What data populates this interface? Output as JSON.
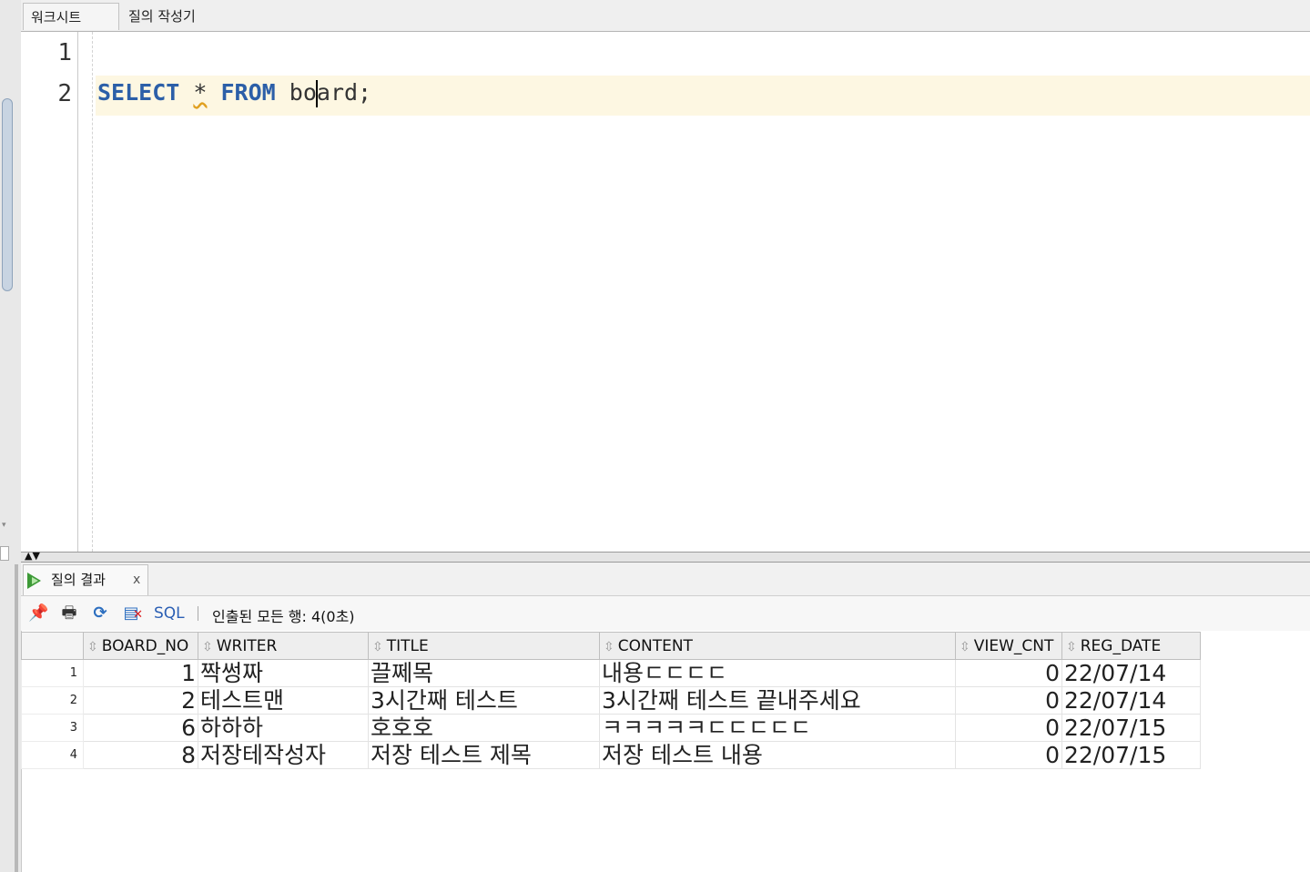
{
  "tabs": {
    "worksheet": "워크시트",
    "query_builder": "질의 작성기"
  },
  "editor": {
    "line_numbers": [
      "1",
      "2"
    ],
    "sql": {
      "kw_select": "SELECT",
      "star": "*",
      "kw_from": "FROM",
      "table_before_caret": "bo",
      "table_after_caret": "ard;"
    }
  },
  "results": {
    "tab_label": "질의 결과",
    "close": "x",
    "toolbar": {
      "sql_label": "SQL",
      "status": "인출된 모든 행: 4(0초)"
    },
    "columns": [
      "BOARD_NO",
      "WRITER",
      "TITLE",
      "CONTENT",
      "VIEW_CNT",
      "REG_DATE"
    ],
    "rows": [
      [
        "1",
        "1",
        "짝썽짜",
        "끌쩨목",
        "내용ㄷㄷㄷㄷ",
        "0",
        "22/07/14"
      ],
      [
        "2",
        "2",
        "테스트맨",
        "3시간째 테스트",
        "3시간째 테스트 끝내주세요",
        "0",
        "22/07/14"
      ],
      [
        "3",
        "6",
        "하하하",
        "호호호",
        "ㅋㅋㅋㅋㅋㄷㄷㄷㄷㄷ",
        "0",
        "22/07/15"
      ],
      [
        "4",
        "8",
        "저장테작성자",
        "저장 테스트 제목",
        "저장 테스트 내용",
        "0",
        "22/07/15"
      ]
    ]
  },
  "colors": {
    "keyword": "#2c5fa8",
    "current_line": "#fdf7e2"
  }
}
